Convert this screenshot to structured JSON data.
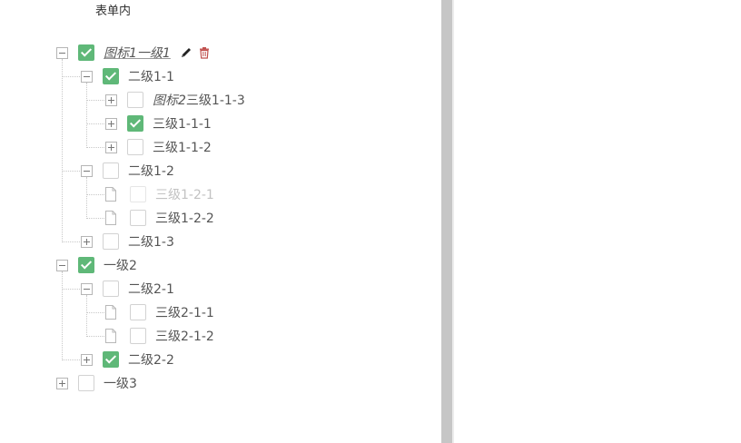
{
  "pane": {
    "title": "表单内"
  },
  "tree": {
    "nodes": [
      {
        "level": 0,
        "switch": "collapse",
        "checked": true,
        "disabled": false,
        "label_italic": "图标1",
        "label_rest": "一级1",
        "italic_all": true,
        "underline": true,
        "ops": [
          "edit-icon",
          "delete-icon"
        ]
      },
      {
        "level": 1,
        "switch": "collapse",
        "checked": true,
        "disabled": false,
        "label_italic": "",
        "label_rest": "二级1-1"
      },
      {
        "level": 2,
        "switch": "expand",
        "checked": false,
        "disabled": false,
        "label_italic": "图标2",
        "label_rest": "三级1-1-3"
      },
      {
        "level": 2,
        "switch": "expand",
        "checked": true,
        "disabled": false,
        "label_italic": "",
        "label_rest": "三级1-1-1"
      },
      {
        "level": 2,
        "switch": "expand",
        "checked": false,
        "disabled": false,
        "label_italic": "",
        "label_rest": "三级1-1-2"
      },
      {
        "level": 1,
        "switch": "collapse",
        "checked": false,
        "disabled": false,
        "label_italic": "",
        "label_rest": "二级1-2"
      },
      {
        "level": 2,
        "switch": "leaf",
        "checked": false,
        "disabled": true,
        "label_italic": "",
        "label_rest": "三级1-2-1"
      },
      {
        "level": 2,
        "switch": "leaf",
        "checked": false,
        "disabled": false,
        "label_italic": "",
        "label_rest": "三级1-2-2"
      },
      {
        "level": 1,
        "switch": "expand",
        "checked": false,
        "disabled": false,
        "label_italic": "",
        "label_rest": "二级1-3"
      },
      {
        "level": 0,
        "switch": "collapse",
        "checked": true,
        "disabled": false,
        "label_italic": "",
        "label_rest": "一级2"
      },
      {
        "level": 1,
        "switch": "collapse",
        "checked": false,
        "disabled": false,
        "label_italic": "",
        "label_rest": "二级2-1"
      },
      {
        "level": 2,
        "switch": "leaf",
        "checked": false,
        "disabled": false,
        "label_italic": "",
        "label_rest": "三级2-1-1"
      },
      {
        "level": 2,
        "switch": "leaf",
        "checked": false,
        "disabled": false,
        "label_italic": "",
        "label_rest": "三级2-1-2"
      },
      {
        "level": 1,
        "switch": "expand",
        "checked": true,
        "disabled": false,
        "label_italic": "",
        "label_rest": "二级2-2"
      },
      {
        "level": 0,
        "switch": "expand",
        "checked": false,
        "disabled": false,
        "label_italic": "",
        "label_rest": "一级3"
      }
    ]
  },
  "colors": {
    "checked": "#5fb878",
    "splitter": "#c6c6c6",
    "delete_icon": "#c0504d"
  }
}
